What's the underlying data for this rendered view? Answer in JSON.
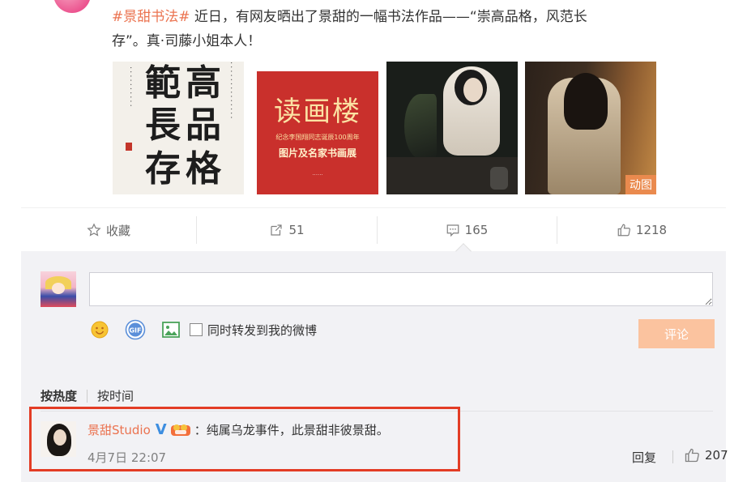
{
  "post": {
    "tag": "#景甜书法#",
    "text_line1": " 近日，有网友晒出了景甜的一幅书法作品——“崇高品格，风范长",
    "text_line2": "存”。真·司藤小姐本人！"
  },
  "images": {
    "calligraphy_chars": [
      "範",
      "長",
      "存",
      "高",
      "品",
      "格"
    ],
    "poster_title": "读画楼",
    "poster_sub": "纪念李国翔同志诞辰100周年",
    "poster_sub2": "图片及名家书画展",
    "animated_badge": "动图"
  },
  "actions": {
    "favorite_label": "收藏",
    "repost_count": "51",
    "comment_count": "165",
    "like_count": "1218"
  },
  "composer": {
    "input_value": "",
    "checkbox_label": "同时转发到我的微博",
    "submit_label": "评论"
  },
  "sort": {
    "hot": "按热度",
    "time": "按时间"
  },
  "comment": {
    "user": "景甜Studio",
    "text": "：纯属乌龙事件，此景甜非彼景甜。",
    "date": "4月7日 22:07",
    "reply_label": "回复",
    "likes": "207"
  },
  "colors": {
    "link_orange": "#eb7350",
    "highlight_red": "#e33c25",
    "submit_disabled": "#fbc39f",
    "verified_blue": "#3d8ee0"
  }
}
